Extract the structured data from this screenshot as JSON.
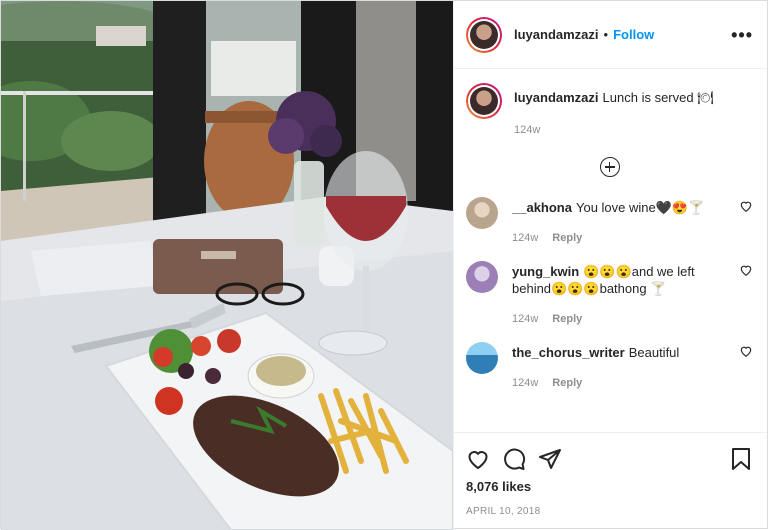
{
  "post": {
    "username": "luyandamzazi",
    "dot": "•",
    "follow_label": "Follow",
    "more_label": "•••",
    "caption": {
      "username": "luyandamzazi",
      "text": "Lunch is served 🍽",
      "age": "124w"
    },
    "comments": [
      {
        "username": "__akhona",
        "text": "You love wine🖤😍🍸",
        "age": "124w",
        "reply": "Reply",
        "avatar_color": "#b9a48e"
      },
      {
        "username": "yung_kwin",
        "text": "😮😮😮and we left behind😮😮😮bathong 🍸",
        "age": "124w",
        "reply": "Reply",
        "avatar_color": "#9d7fb7"
      },
      {
        "username": "the_chorus_writer",
        "text": "Beautiful",
        "age": "124w",
        "reply": "Reply",
        "avatar_color": "#2f7fb6"
      }
    ],
    "likes": "8,076 likes",
    "date": "APRIL 10, 2018"
  },
  "icons": {
    "like": "heart-icon",
    "comment": "comment-icon",
    "share": "share-icon",
    "save": "bookmark-icon",
    "load_more": "plus-circle-icon"
  },
  "colors": {
    "follow": "#0095f6",
    "text": "#262626",
    "muted": "#8e8e8e"
  }
}
